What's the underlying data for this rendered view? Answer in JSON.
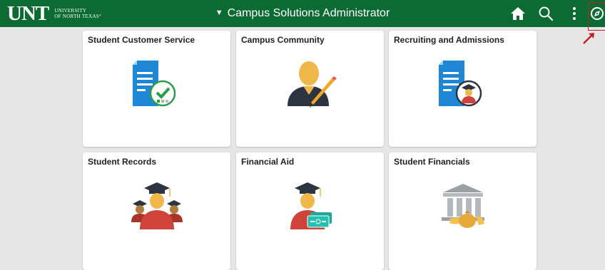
{
  "header": {
    "logo": {
      "mark": "UNT",
      "line1": "UNIVERSITY",
      "line2": "OF NORTH TEXAS°"
    },
    "title": "Campus Solutions Administrator",
    "title_caret": "▼",
    "icons": [
      "home-icon",
      "search-icon",
      "actions-menu-icon",
      "navbar-icon"
    ],
    "background": "#0c6b32"
  },
  "tiles": [
    {
      "title": "Student Customer Service",
      "icon": "document-check-icon"
    },
    {
      "title": "Campus Community",
      "icon": "person-pencil-icon"
    },
    {
      "title": "Recruiting and Admissions",
      "icon": "document-graduate-icon"
    },
    {
      "title": "Student Records",
      "icon": "graduates-group-icon"
    },
    {
      "title": "Financial Aid",
      "icon": "graduate-money-icon"
    },
    {
      "title": "Student Financials",
      "icon": "bank-money-icon"
    }
  ]
}
